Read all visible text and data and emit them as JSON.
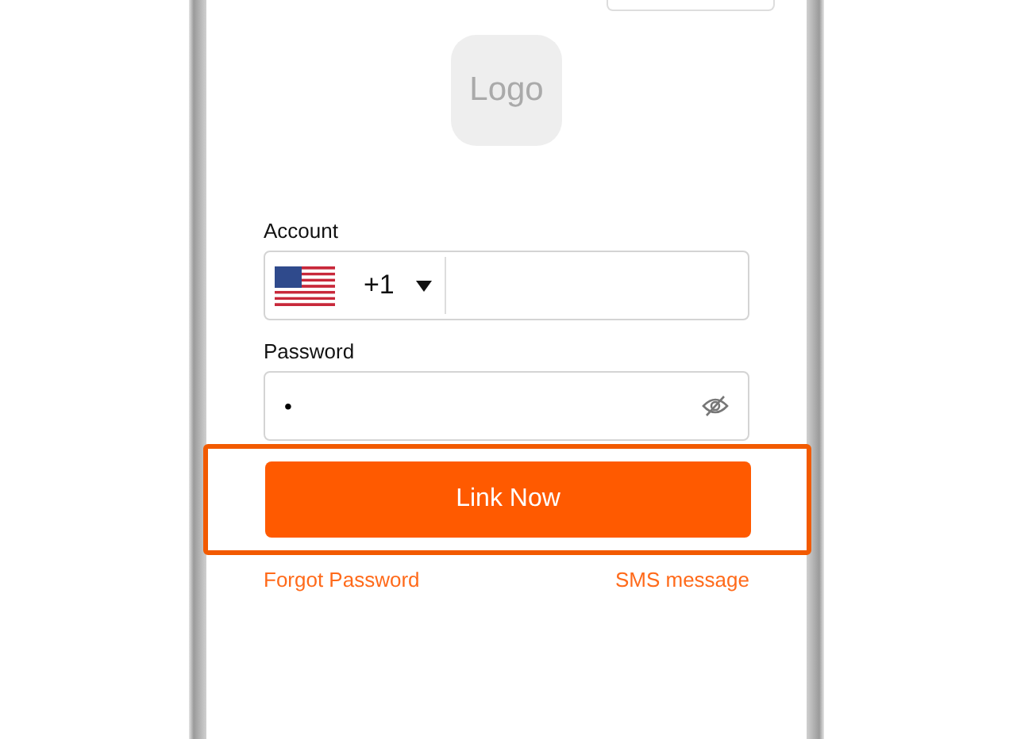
{
  "logo": {
    "text": "Logo"
  },
  "account": {
    "label": "Account",
    "country_code": "+1"
  },
  "password": {
    "label": "Password",
    "value": "•"
  },
  "highlight": {
    "on": true
  },
  "submit": {
    "label": "Link Now"
  },
  "links": [
    "Forgot Password",
    "SMS message"
  ]
}
